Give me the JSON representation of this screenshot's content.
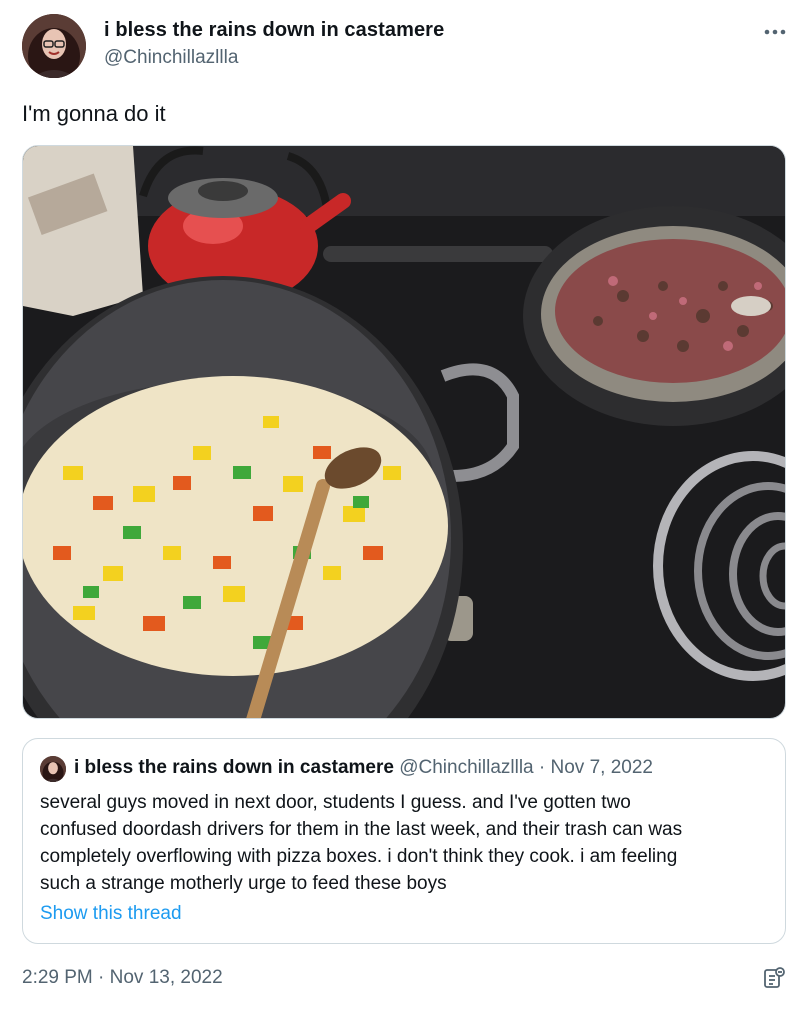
{
  "author": {
    "display_name": "i bless the rains down in castamere",
    "handle": "@Chinchillazllla"
  },
  "tweet": {
    "text": "I'm gonna do it",
    "timestamp": "2:29 PM · Nov 13, 2022"
  },
  "quoted": {
    "display_name": "i bless the rains down in castamere",
    "meta": "@Chinchillazllla · Nov 7, 2022",
    "lines": [
      "several guys moved in next door, students I guess. and I've gotten two",
      "confused doordash drivers for them in the last week, and their trash can was",
      "completely overflowing with pizza boxes. i don't think they cook. i am feeling",
      "such a strange motherly urge to feed these boys"
    ],
    "show_thread_label": "Show this thread"
  },
  "icons": {
    "more": "more-horizontal-icon",
    "analytics": "analytics-icon"
  },
  "colors": {
    "link": "#1d9bf0",
    "secondary_text": "#536471",
    "border": "#cfd9de"
  }
}
